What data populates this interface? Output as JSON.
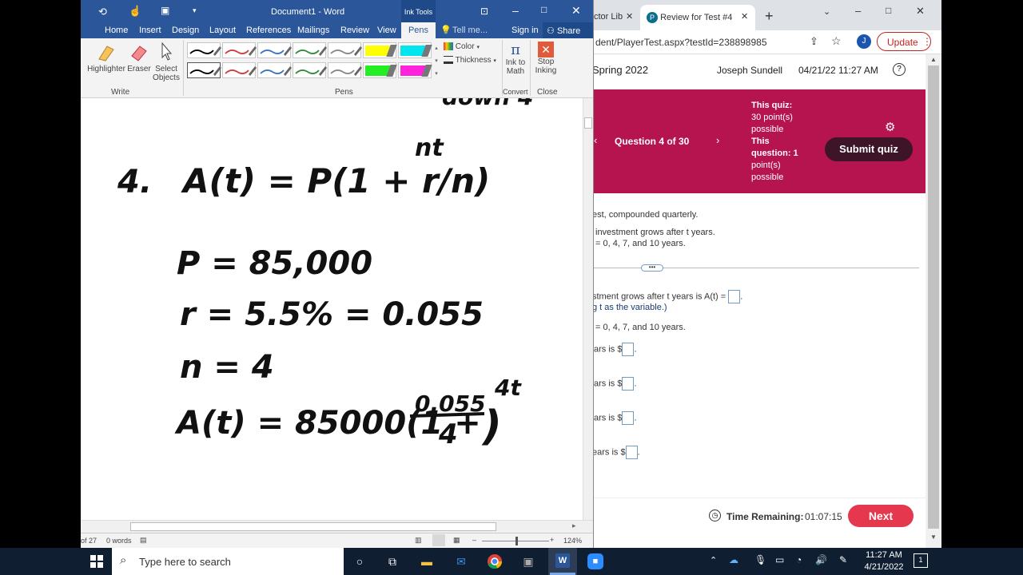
{
  "word": {
    "title": "Document1 - Word",
    "tools_label": "Ink Tools",
    "tabs": [
      "Home",
      "Insert",
      "Design",
      "Layout",
      "References",
      "Mailings",
      "Review",
      "View",
      "Pens"
    ],
    "sign_in": "Sign in",
    "share": "Share",
    "tell_me": "Tell me...",
    "ribbon": {
      "highlighter": "Highlighter",
      "eraser": "Eraser",
      "select_objects": [
        "Select",
        "Objects"
      ],
      "group_write": "Write",
      "group_pens": "Pens",
      "color": "Color",
      "thickness": "Thickness",
      "ink_to_math": [
        "Ink to",
        "Math"
      ],
      "stop_inking": [
        "Stop",
        "Inking"
      ],
      "group_convert": "Convert",
      "group_close": "Close"
    },
    "pen_colors": [
      "#000000",
      "#d33b3b",
      "#3a74c4",
      "#2e8b3c",
      "#888888",
      "#ffff00",
      "#00e5ee",
      "#000000",
      "#d33b3b",
      "#3a74c4",
      "#2e8b3c",
      "#888888",
      "#22ee22",
      "#ff22dd"
    ],
    "ink": {
      "top_scrawl": "down 4",
      "problem_num": "4.",
      "formula": "A(t) = P(1 + r/n)",
      "exp_nt": "nt",
      "p_line": "P = 85,000",
      "r_line": "r = 5.5% = 0.055",
      "n_line": "n = 4",
      "final_lhs": "A(t) = 85000(1 +",
      "final_num": "0.055",
      "final_den": "4",
      "final_rp": ")",
      "exp_4t": "4t"
    },
    "status": {
      "pages": "of 27",
      "words": "0 words",
      "zoom": "124%"
    }
  },
  "chrome": {
    "tab1": "ctor Lib",
    "tab2": "Review for Test #4",
    "url": "dent/PlayerTest.aspx?testId=238898985",
    "avatar": "J",
    "update": "Update",
    "course": "Spring 2022",
    "user": "Joseph Sundell",
    "datetime": "04/21/22 11:27 AM",
    "question_label": "Question 4 of 30",
    "quiz_info": [
      "This quiz:",
      "30 point(s)",
      "possible",
      "This",
      "question: 1",
      "point(s)",
      "possible"
    ],
    "submit": "Submit quiz",
    "q_lines": [
      "est, compounded quarterly.",
      "investment grows after t years.",
      "= 0, 4, 7, and 10 years."
    ],
    "ans_line1": "stment grows after t years is A(t) =",
    "ans_line1b": "g t as the variable.)",
    "ans_line2": "= 0, 4, 7, and 10 years.",
    "ars": [
      "ars is $",
      "ars is $",
      "ars is $",
      "ears is $"
    ],
    "time_label": "Time Remaining:",
    "time_value": "01:07:15",
    "next": "Next"
  },
  "taskbar": {
    "search": "Type here to search",
    "time": "11:27 AM",
    "date": "4/21/2022"
  }
}
